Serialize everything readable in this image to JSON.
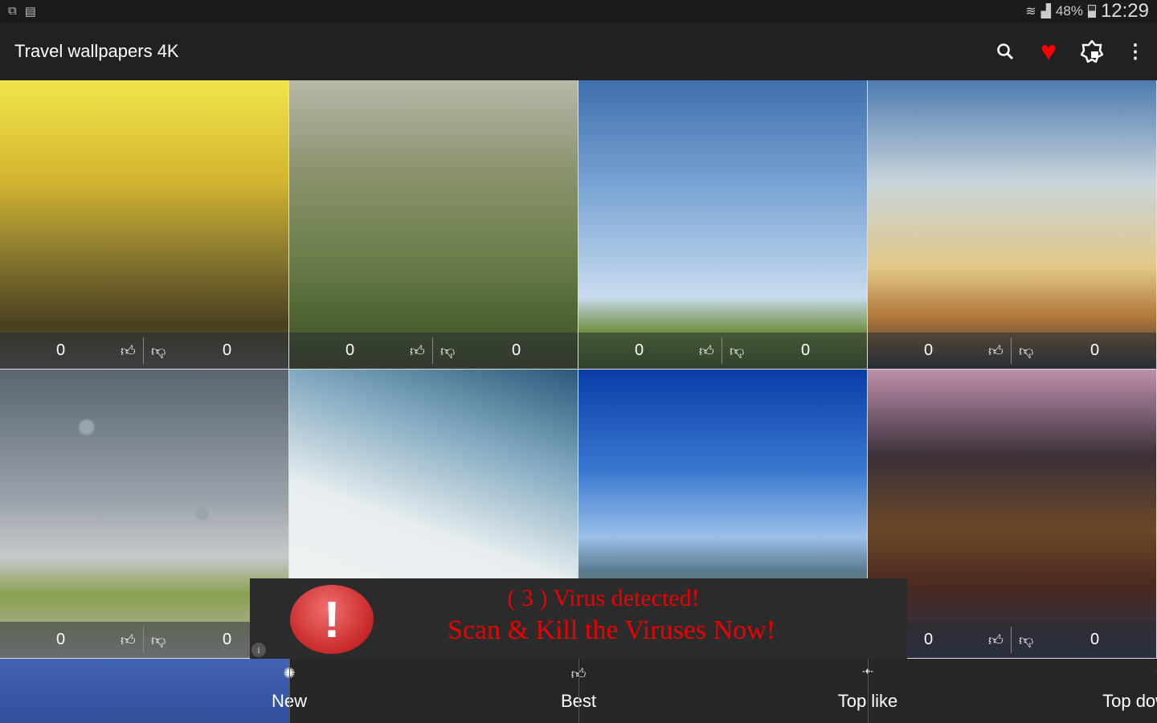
{
  "status_bar": {
    "battery": "48%",
    "time": "12:29",
    "icons": [
      "cast-icon",
      "screenshot-icon",
      "wifi-icon",
      "signal-icon",
      "battery-icon"
    ]
  },
  "toolbar": {
    "title": "Travel wallpapers 4K",
    "icons": [
      "search-icon",
      "heart-icon",
      "rate-badge-icon",
      "more-vert-icon"
    ],
    "heart_color": "#ff0000"
  },
  "wallpapers": [
    {
      "likes": "0",
      "dislikes": "0"
    },
    {
      "likes": "0",
      "dislikes": "0"
    },
    {
      "likes": "0",
      "dislikes": "0"
    },
    {
      "likes": "0",
      "dislikes": "0"
    },
    {
      "likes": "0",
      "dislikes": "0"
    },
    {
      "likes": "",
      "dislikes": ""
    },
    {
      "likes": "",
      "dislikes": ""
    },
    {
      "likes": "0",
      "dislikes": "0"
    }
  ],
  "ad": {
    "line1": "( 3 )  Virus detected!",
    "line2": "Scan & Kill the Viruses Now!",
    "icon": "!",
    "info": "i",
    "text_color": "#e00000"
  },
  "bottom_nav": [
    {
      "label": "New",
      "icon": "new-badge-icon",
      "active": true
    },
    {
      "label": "Best",
      "icon": "thumb-up-icon"
    },
    {
      "label": "Top like",
      "icon": "top-like-icon"
    },
    {
      "label": "Top download",
      "icon": "download-icon"
    }
  ],
  "accent_color": "#3a5aab"
}
